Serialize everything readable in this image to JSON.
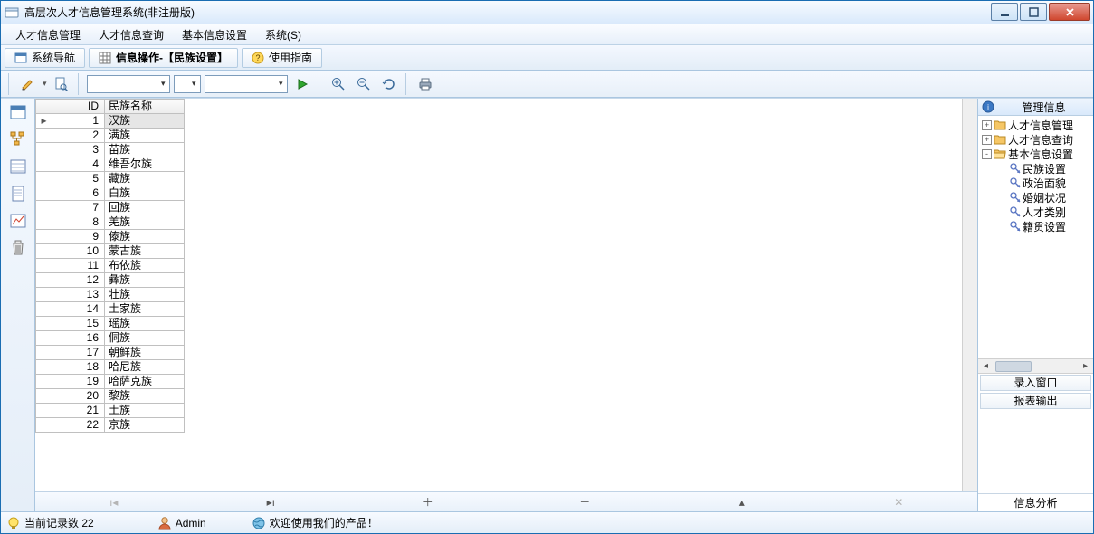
{
  "window": {
    "title": "高层次人才信息管理系统(非注册版)"
  },
  "menus": [
    {
      "label": "人才信息管理"
    },
    {
      "label": "人才信息查询"
    },
    {
      "label": "基本信息设置"
    },
    {
      "label": "系统(S)"
    }
  ],
  "tabs": {
    "nav": {
      "label": "系统导航"
    },
    "current": {
      "label": "信息操作-【民族设置】"
    },
    "guide": {
      "label": "使用指南"
    }
  },
  "toolbar": {
    "combo1": "",
    "combo2": "",
    "combo3": ""
  },
  "grid": {
    "columns": {
      "id": "ID",
      "name": "民族名称"
    },
    "rows": [
      {
        "id": 1,
        "name": "汉族"
      },
      {
        "id": 2,
        "name": "满族"
      },
      {
        "id": 3,
        "name": "苗族"
      },
      {
        "id": 4,
        "name": "维吾尔族"
      },
      {
        "id": 5,
        "name": "藏族"
      },
      {
        "id": 6,
        "name": "白族"
      },
      {
        "id": 7,
        "name": "回族"
      },
      {
        "id": 8,
        "name": "羌族"
      },
      {
        "id": 9,
        "name": "傣族"
      },
      {
        "id": 10,
        "name": "蒙古族"
      },
      {
        "id": 11,
        "name": "布依族"
      },
      {
        "id": 12,
        "name": "彝族"
      },
      {
        "id": 13,
        "name": "壮族"
      },
      {
        "id": 14,
        "name": "土家族"
      },
      {
        "id": 15,
        "name": "瑶族"
      },
      {
        "id": 16,
        "name": "侗族"
      },
      {
        "id": 17,
        "name": "朝鲜族"
      },
      {
        "id": 18,
        "name": "哈尼族"
      },
      {
        "id": 19,
        "name": "哈萨克族"
      },
      {
        "id": 20,
        "name": "黎族"
      },
      {
        "id": 21,
        "name": "土族"
      },
      {
        "id": 22,
        "name": "京族"
      }
    ],
    "selected_index": 0
  },
  "right": {
    "title": "管理信息",
    "tree": [
      {
        "level": 1,
        "expand": "+",
        "icon": "folder",
        "label": "人才信息管理"
      },
      {
        "level": 1,
        "expand": "+",
        "icon": "folder",
        "label": "人才信息查询"
      },
      {
        "level": 1,
        "expand": "-",
        "icon": "folder-open",
        "label": "基本信息设置"
      },
      {
        "level": 2,
        "expand": "",
        "icon": "key",
        "label": "民族设置"
      },
      {
        "level": 2,
        "expand": "",
        "icon": "key",
        "label": "政治面貌"
      },
      {
        "level": 2,
        "expand": "",
        "icon": "key",
        "label": "婚姻状况"
      },
      {
        "level": 2,
        "expand": "",
        "icon": "key",
        "label": "人才类别"
      },
      {
        "level": 2,
        "expand": "",
        "icon": "key",
        "label": "籍贯设置"
      }
    ],
    "btn_input": "录入窗口",
    "btn_report": "报表输出",
    "footer": "信息分析"
  },
  "status": {
    "records": "当前记录数 22",
    "user": "Admin",
    "welcome": "欢迎使用我们的产品！"
  }
}
